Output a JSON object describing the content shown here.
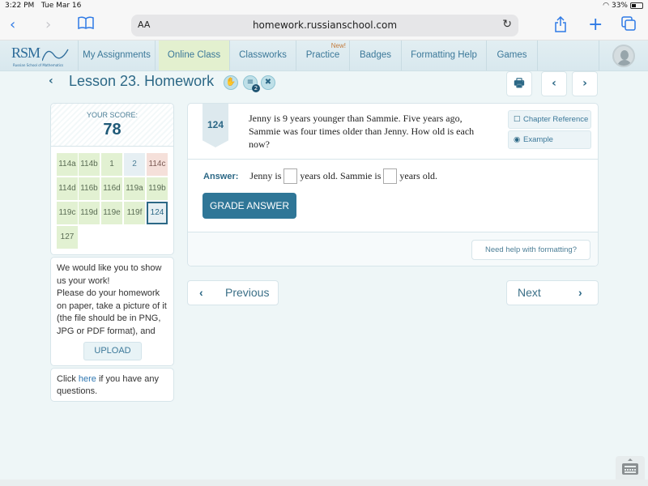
{
  "statusbar": {
    "time": "3:22 PM",
    "date": "Tue Mar 16",
    "battery": "33%",
    "battery_level": 0.33,
    "wifi_icon": "wifi-icon"
  },
  "browser": {
    "url": "homework.russianschool.com",
    "text_size_label": "AA",
    "icons": [
      "back-icon",
      "forward-icon",
      "bookmarks-icon",
      "reload-icon",
      "share-icon",
      "new-tab-icon",
      "tabs-icon"
    ]
  },
  "nav": {
    "logo_text": "RSM",
    "logo_subtitle": "Russian School of Mathematics",
    "items": [
      {
        "label": "My Assignments"
      },
      {
        "label": "Online Class",
        "active": true
      },
      {
        "label": "Classworks"
      },
      {
        "label": "Practice",
        "badge": "New!"
      },
      {
        "label": "Badges"
      },
      {
        "label": "Formatting Help"
      },
      {
        "label": "Games"
      }
    ]
  },
  "lesson": {
    "title": "Lesson 23. Homework",
    "badge_count": "2"
  },
  "score": {
    "label": "YOUR SCORE:",
    "value": "78"
  },
  "problems": [
    {
      "label": "114a",
      "status": "correct"
    },
    {
      "label": "114b",
      "status": "correct"
    },
    {
      "label": "1",
      "status": "correct"
    },
    {
      "label": "2",
      "status": "unanswered"
    },
    {
      "label": "114c",
      "status": "incorrect"
    },
    {
      "label": "114d",
      "status": "correct"
    },
    {
      "label": "116b",
      "status": "correct"
    },
    {
      "label": "116d",
      "status": "correct"
    },
    {
      "label": "119a",
      "status": "correct"
    },
    {
      "label": "119b",
      "status": "correct"
    },
    {
      "label": "119c",
      "status": "correct"
    },
    {
      "label": "119d",
      "status": "correct"
    },
    {
      "label": "119e",
      "status": "correct"
    },
    {
      "label": "119f",
      "status": "correct"
    },
    {
      "label": "124",
      "status": "current"
    },
    {
      "label": "127",
      "status": "correct"
    }
  ],
  "upload": {
    "text": "We would like you to show us your work! Please do your homework on paper, take a picture of it (the file should be in PNG, JPG or PDF format), and",
    "line1": "We would like you to show",
    "line2": "us your work!",
    "line3": "Please do your homework",
    "line4": "on paper, take a picture of it",
    "line5": "(the file should be in PNG,",
    "line6": "JPG or PDF format), and",
    "button": "UPLOAD"
  },
  "help": {
    "prefix": "Click ",
    "link": "here",
    "suffix": " if you have any questions."
  },
  "question": {
    "number": "124",
    "text": "Jenny is 9 years younger than Sammie. Five years ago, Sammie was four times older than Jenny. How old is each now?",
    "chapter_reference": "Chapter Reference",
    "example": "Example",
    "answer_label": "Answer:",
    "answer_part1": "Jenny is",
    "answer_part2": "years old. Sammie is",
    "answer_part3": "years old.",
    "answer_value1": "",
    "answer_value2": "",
    "grade_button": "GRADE ANSWER",
    "formatting_help": "Need help with formatting?"
  },
  "pager": {
    "previous": "Previous",
    "next": "Next"
  }
}
